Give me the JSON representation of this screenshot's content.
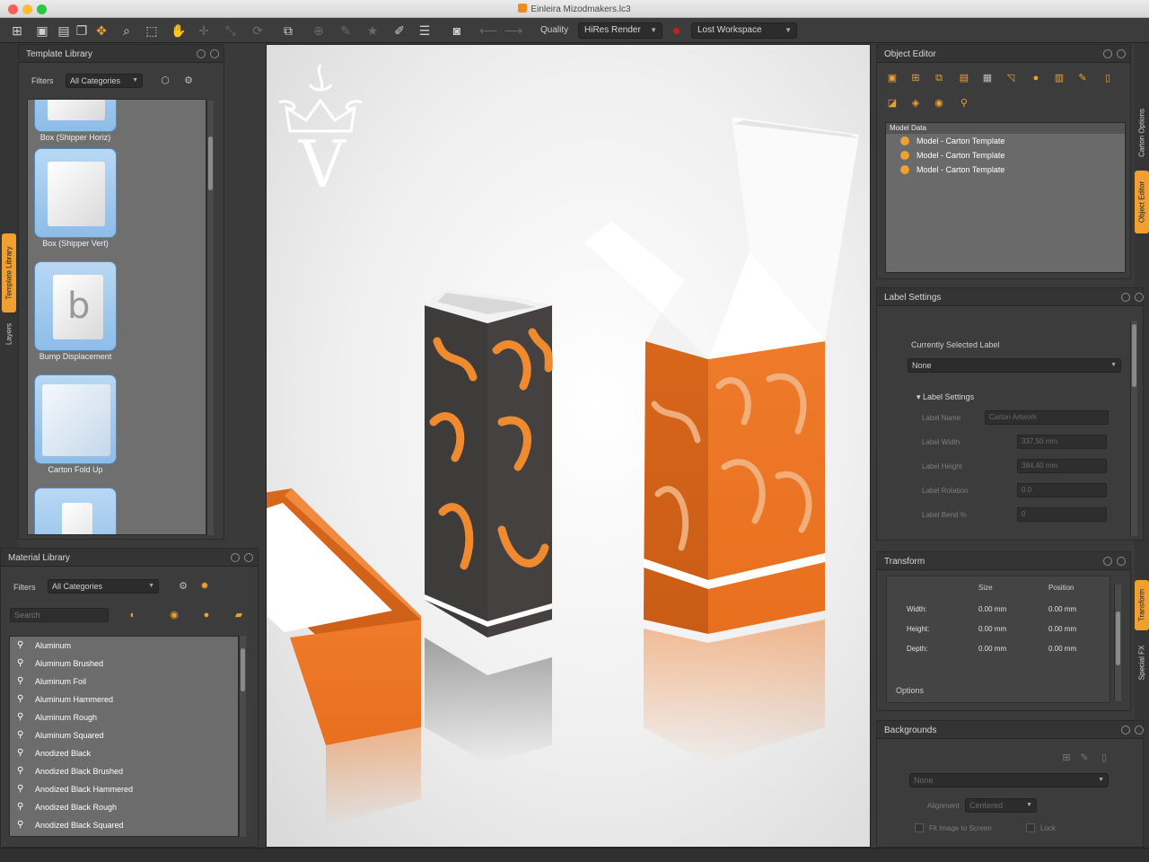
{
  "window": {
    "title": "Einleira Mizodmakers.lc3"
  },
  "toolbar": {
    "quality_label": "Quality",
    "quality_value": "HiRes Render",
    "workspace_value": "Lost Workspace"
  },
  "left_tabs": [
    "Template Library",
    "Layers"
  ],
  "right_tabs": [
    "Carton Options",
    "Object Editor",
    "Transform",
    "Special FX"
  ],
  "template_library": {
    "title": "Template Library",
    "filters_label": "Filters",
    "filter_value": "All Categories",
    "items": [
      "Box (Shipper Horiz)",
      "Box (Shipper Vert)",
      "Bump Displacement",
      "Carton Fold Up"
    ]
  },
  "material_library": {
    "title": "Material Library",
    "filters_label": "Filters",
    "filter_value": "All Categories",
    "search_placeholder": "Search",
    "items": [
      "Aluminum",
      "Aluminum Brushed",
      "Aluminum Foil",
      "Aluminum Hammered",
      "Aluminum Rough",
      "Aluminum Squared",
      "Anodized Black",
      "Anodized Black Brushed",
      "Anodized Black Hammered",
      "Anodized Black Rough",
      "Anodized Black Squared"
    ]
  },
  "object_editor": {
    "title": "Object Editor",
    "tree_header": "Model Data",
    "tree_items": [
      "Model - Carton Template",
      "Model - Carton Template",
      "Model - Carton Template"
    ]
  },
  "label_settings": {
    "title": "Label Settings",
    "currently_selected_label": "Currently Selected Label",
    "selected_value": "None",
    "section_title": "Label Settings",
    "fields": [
      {
        "label": "Label Name",
        "value": "Carton Artwork"
      },
      {
        "label": "Label Width",
        "value": "337,50 mm"
      },
      {
        "label": "Label Height",
        "value": "384,40 mm"
      },
      {
        "label": "Label Rotation",
        "value": "0.0"
      },
      {
        "label": "Label Bend %",
        "value": "0"
      }
    ]
  },
  "transform": {
    "title": "Transform",
    "col_size": "Size",
    "col_position": "Position",
    "rows": [
      {
        "label": "Width:",
        "size": "0.00 mm",
        "position": "0.00 mm"
      },
      {
        "label": "Height:",
        "size": "0.00 mm",
        "position": "0.00 mm"
      },
      {
        "label": "Depth:",
        "size": "0.00 mm",
        "position": "0.00 mm"
      }
    ],
    "options_label": "Options"
  },
  "backgrounds": {
    "title": "Backgrounds",
    "select_value": "None",
    "alignment_label": "Alignment",
    "alignment_value": "Centered",
    "fit_label": "Fit Image to Screen",
    "lock_label": "Lock"
  },
  "viewport": {
    "logo_letter": "V"
  },
  "colors": {
    "accent": "#f0a030",
    "panel": "#3c3c3c",
    "carton_orange": "#ee7b2a",
    "carton_dark": "#3e3b3b"
  }
}
